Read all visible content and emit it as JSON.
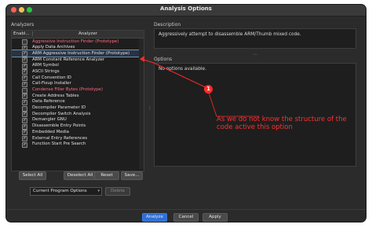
{
  "window": {
    "title": "Analysis Options"
  },
  "analyzers_panel": {
    "label": "Analyzers",
    "headers": {
      "enabled": "Enabl...",
      "analyzer": "Analyzer"
    },
    "rows": [
      {
        "name": "Aggressive Instruction Finder (Prototype)",
        "checked": false,
        "prototype": true
      },
      {
        "name": "Apply Data Archives",
        "checked": true,
        "prototype": false
      },
      {
        "name": "ARM Aggressive Instruction Finder (Prototype)",
        "checked": true,
        "prototype": false,
        "selected": true
      },
      {
        "name": "ARM Constant Reference Analyzer",
        "checked": true,
        "prototype": false
      },
      {
        "name": "ARM Symbol",
        "checked": true,
        "prototype": false
      },
      {
        "name": "ASCII Strings",
        "checked": true,
        "prototype": false
      },
      {
        "name": "Call Convention ID",
        "checked": true,
        "prototype": false
      },
      {
        "name": "Call-Fixup Installer",
        "checked": true,
        "prototype": false
      },
      {
        "name": "Condense Filler Bytes (Prototype)",
        "checked": false,
        "prototype": true
      },
      {
        "name": "Create Address Tables",
        "checked": true,
        "prototype": false
      },
      {
        "name": "Data Reference",
        "checked": true,
        "prototype": false
      },
      {
        "name": "Decompiler Parameter ID",
        "checked": false,
        "prototype": false
      },
      {
        "name": "Decompiler Switch Analysis",
        "checked": true,
        "prototype": false
      },
      {
        "name": "Demangler GNU",
        "checked": true,
        "prototype": false
      },
      {
        "name": "Disassemble Entry Points",
        "checked": true,
        "prototype": false
      },
      {
        "name": "Embedded Media",
        "checked": true,
        "prototype": false
      },
      {
        "name": "External Entry References",
        "checked": true,
        "prototype": false
      },
      {
        "name": "Function Start Pre Search",
        "checked": true,
        "prototype": false
      }
    ],
    "buttons": {
      "select_all": "Select All",
      "deselect_all": "Deselect All",
      "reset": "Reset",
      "save": "Save..."
    },
    "profile": {
      "selected": "Current Program Options",
      "delete": "Delete"
    }
  },
  "description_panel": {
    "label": "Description",
    "text": "Aggressively attempt to disassemble ARM/Thumb mixed code."
  },
  "options_panel": {
    "label": "Options",
    "empty_text": "No options available."
  },
  "dialog_buttons": {
    "analyze": "Analyze",
    "cancel": "Cancel",
    "apply": "Apply"
  },
  "annotation": {
    "marker": "1",
    "text": "As we do not know the structure of the code active this option",
    "color": "#ff2a2a"
  }
}
